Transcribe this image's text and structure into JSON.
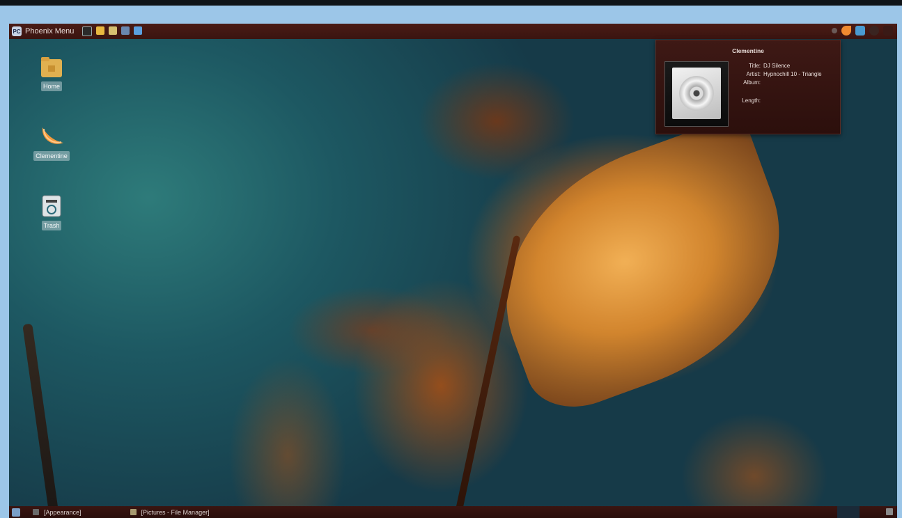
{
  "panel": {
    "menu_label": "Phoenix Menu",
    "logo_text": "PC",
    "launchers": [
      "terminal-icon",
      "file-manager-icon",
      "text-editor-icon",
      "image-viewer-icon",
      "browser-icon"
    ],
    "tray_icons": [
      "network-icon",
      "clementine-icon",
      "display-icon",
      "power-icon",
      "clock-icon"
    ]
  },
  "desktop": {
    "icons": [
      {
        "label": "Home",
        "icon": "home-folder-icon"
      },
      {
        "label": "Clementine",
        "icon": "clementine-icon"
      },
      {
        "label": "Trash",
        "icon": "trash-icon"
      }
    ]
  },
  "popup": {
    "title": "Clementine",
    "labels": {
      "title": "Title:",
      "artist": "Artist:",
      "album": "Album:",
      "length": "Length:"
    },
    "values": {
      "title": "DJ Silence",
      "artist": "Hypnochill 10 - Triangle",
      "album": "",
      "length": ""
    }
  },
  "taskbar": {
    "tasks": [
      {
        "label": "[Appearance]",
        "icon": "appearance-icon"
      },
      {
        "label": "[Pictures - File Manager]",
        "icon": "file-manager-icon"
      }
    ]
  },
  "colors": {
    "panel": "#4a1c16",
    "desktop_teal": "#1d5862",
    "leaf_orange": "#d98a2e",
    "page_background": "#9cc6e8"
  }
}
